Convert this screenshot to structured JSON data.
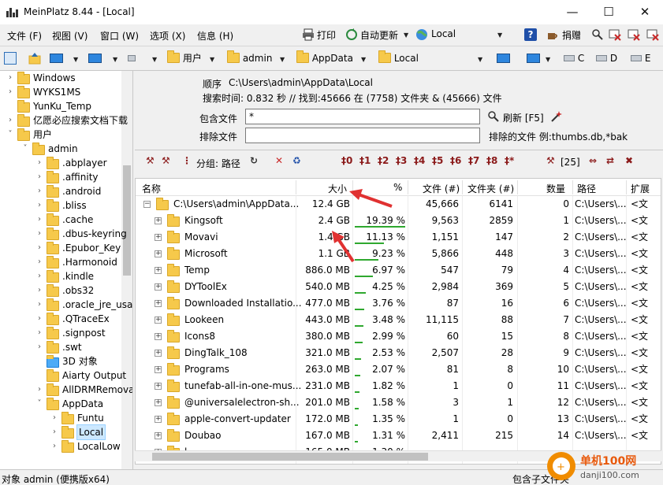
{
  "window": {
    "title": "MeinPlatz 8.44 - [Local]"
  },
  "menu": [
    "文件 (F)",
    "视图 (V)",
    "窗口 (W)",
    "选项 (X)",
    "信息 (H)"
  ],
  "toolbar": {
    "print": "打印",
    "autoupdate": "自动更新",
    "location": "Local",
    "donate": "捐赠"
  },
  "path": {
    "crumbs": [
      "用户",
      "admin",
      "AppData",
      "Local"
    ],
    "drives": [
      "C",
      "D",
      "E"
    ]
  },
  "tree": [
    {
      "label": "Windows",
      "depth": 1,
      "expander": ">"
    },
    {
      "label": "WYKS1MS",
      "depth": 1,
      "expander": ">"
    },
    {
      "label": "YunKu_Temp",
      "depth": 1,
      "expander": ""
    },
    {
      "label": "亿愿必应搜索文档下载",
      "depth": 1,
      "expander": ">"
    },
    {
      "label": "用户",
      "depth": 1,
      "expander": "v"
    },
    {
      "label": "admin",
      "depth": 2,
      "expander": "v"
    },
    {
      "label": ".abplayer",
      "depth": 3,
      "expander": ">"
    },
    {
      "label": ".affinity",
      "depth": 3,
      "expander": ">"
    },
    {
      "label": ".android",
      "depth": 3,
      "expander": ">"
    },
    {
      "label": ".bliss",
      "depth": 3,
      "expander": ">"
    },
    {
      "label": ".cache",
      "depth": 3,
      "expander": ">"
    },
    {
      "label": ".dbus-keyring",
      "depth": 3,
      "expander": ">"
    },
    {
      "label": ".Epubor_Key",
      "depth": 3,
      "expander": ">"
    },
    {
      "label": ".Harmonoid",
      "depth": 3,
      "expander": ">"
    },
    {
      "label": ".kindle",
      "depth": 3,
      "expander": ">"
    },
    {
      "label": ".obs32",
      "depth": 3,
      "expander": ">"
    },
    {
      "label": ".oracle_jre_usage",
      "depth": 3,
      "expander": ">"
    },
    {
      "label": ".QTraceEx",
      "depth": 3,
      "expander": ">"
    },
    {
      "label": ".signpost",
      "depth": 3,
      "expander": ">"
    },
    {
      "label": ".swt",
      "depth": 3,
      "expander": ">"
    },
    {
      "label": "3D 对象",
      "depth": 3,
      "expander": "",
      "icon": "cube"
    },
    {
      "label": "Aiarty Output",
      "depth": 3,
      "expander": ""
    },
    {
      "label": "AllDRMRemoval",
      "depth": 3,
      "expander": ">"
    },
    {
      "label": "AppData",
      "depth": 3,
      "expander": "v"
    },
    {
      "label": "Funtu",
      "depth": 4,
      "expander": ">"
    },
    {
      "label": "Local",
      "depth": 4,
      "expander": ">",
      "selected": true
    },
    {
      "label": "LocalLow",
      "depth": 4,
      "expander": ">"
    }
  ],
  "info": {
    "order_label": "顺序",
    "order_path": "C:\\Users\\admin\\AppData\\Local",
    "search_time": "搜索时间: 0.832 秒 //  找到:45666 在 (7758) 文件夹 & (45666) 文件",
    "include_label": "包含文件",
    "include_value": "*",
    "exclude_label": "排除文件",
    "exclude_value": "",
    "refresh": "刷新 [F5]",
    "excluded_files": "排除的文件 例:thumbs.db,*bak"
  },
  "toolbar2": {
    "group_by": "分组: 路径",
    "count": "[25]"
  },
  "columns": [
    "名称",
    "大小",
    "%",
    "文件 (#)",
    "文件夹 (#)",
    "数量",
    "路径",
    "扩展"
  ],
  "root": {
    "name": "C:\\Users\\admin\\AppData...",
    "size": "12.4 GB",
    "pct": "",
    "files": "45,666",
    "folders": "6141",
    "count": "0",
    "path": "C:\\Users\\...",
    "ext": "<文"
  },
  "rows": [
    {
      "name": "Kingsoft",
      "size": "2.4 GB",
      "pct": "19.39 %",
      "pct_value": 19.39,
      "files": "9,563",
      "folders": "2859",
      "count": "1",
      "path": "C:\\Users\\...",
      "ext": "<文"
    },
    {
      "name": "Movavi",
      "size": "1.4 GB",
      "pct": "11.13 %",
      "pct_value": 11.13,
      "files": "1,151",
      "folders": "147",
      "count": "2",
      "path": "C:\\Users\\...",
      "ext": "<文"
    },
    {
      "name": "Microsoft",
      "size": "1.1 GB",
      "pct": "9.23 %",
      "pct_value": 9.23,
      "files": "5,866",
      "folders": "448",
      "count": "3",
      "path": "C:\\Users\\...",
      "ext": "<文"
    },
    {
      "name": "Temp",
      "size": "886.0 MB",
      "pct": "6.97 %",
      "pct_value": 6.97,
      "files": "547",
      "folders": "79",
      "count": "4",
      "path": "C:\\Users\\...",
      "ext": "<文"
    },
    {
      "name": "DYToolEx",
      "size": "540.0 MB",
      "pct": "4.25 %",
      "pct_value": 4.25,
      "files": "2,984",
      "folders": "369",
      "count": "5",
      "path": "C:\\Users\\...",
      "ext": "<文"
    },
    {
      "name": "Downloaded Installatio...",
      "size": "477.0 MB",
      "pct": "3.76 %",
      "pct_value": 3.76,
      "files": "87",
      "folders": "16",
      "count": "6",
      "path": "C:\\Users\\...",
      "ext": "<文"
    },
    {
      "name": "Lookeen",
      "size": "443.0 MB",
      "pct": "3.48 %",
      "pct_value": 3.48,
      "files": "11,115",
      "folders": "88",
      "count": "7",
      "path": "C:\\Users\\...",
      "ext": "<文"
    },
    {
      "name": "Icons8",
      "size": "380.0 MB",
      "pct": "2.99 %",
      "pct_value": 2.99,
      "files": "60",
      "folders": "15",
      "count": "8",
      "path": "C:\\Users\\...",
      "ext": "<文"
    },
    {
      "name": "DingTalk_108",
      "size": "321.0 MB",
      "pct": "2.53 %",
      "pct_value": 2.53,
      "files": "2,507",
      "folders": "28",
      "count": "9",
      "path": "C:\\Users\\...",
      "ext": "<文"
    },
    {
      "name": "Programs",
      "size": "263.0 MB",
      "pct": "2.07 %",
      "pct_value": 2.07,
      "files": "81",
      "folders": "8",
      "count": "10",
      "path": "C:\\Users\\...",
      "ext": "<文"
    },
    {
      "name": "tunefab-all-in-one-mus...",
      "size": "231.0 MB",
      "pct": "1.82 %",
      "pct_value": 1.82,
      "files": "1",
      "folders": "0",
      "count": "11",
      "path": "C:\\Users\\...",
      "ext": "<文"
    },
    {
      "name": "@universalelectron-sh...",
      "size": "201.0 MB",
      "pct": "1.58 %",
      "pct_value": 1.58,
      "files": "3",
      "folders": "1",
      "count": "12",
      "path": "C:\\Users\\...",
      "ext": "<文"
    },
    {
      "name": "apple-convert-updater",
      "size": "172.0 MB",
      "pct": "1.35 %",
      "pct_value": 1.35,
      "files": "1",
      "folders": "0",
      "count": "13",
      "path": "C:\\Users\\...",
      "ext": "<文"
    },
    {
      "name": "Doubao",
      "size": "167.0 MB",
      "pct": "1.31 %",
      "pct_value": 1.31,
      "files": "2,411",
      "folders": "215",
      "count": "14",
      "path": "C:\\Users\\...",
      "ext": "<文"
    },
    {
      "name": "l...",
      "size": "165.0 MB",
      "pct": "1.30 %",
      "pct_value": 1.3,
      "files": "",
      "folders": "",
      "count": "",
      "path": "",
      "ext": ""
    }
  ],
  "status": {
    "left": "对象 admin (便携版x64)",
    "right": "包含子文件夹"
  },
  "watermark": {
    "line1": "单机100网",
    "line2": "danji100.com"
  },
  "colors": {
    "accent_red": "#8b1a1a",
    "pct_green": "#2fa82f",
    "folder_yellow": "#f6c94b",
    "arrow_red": "#e03131"
  }
}
